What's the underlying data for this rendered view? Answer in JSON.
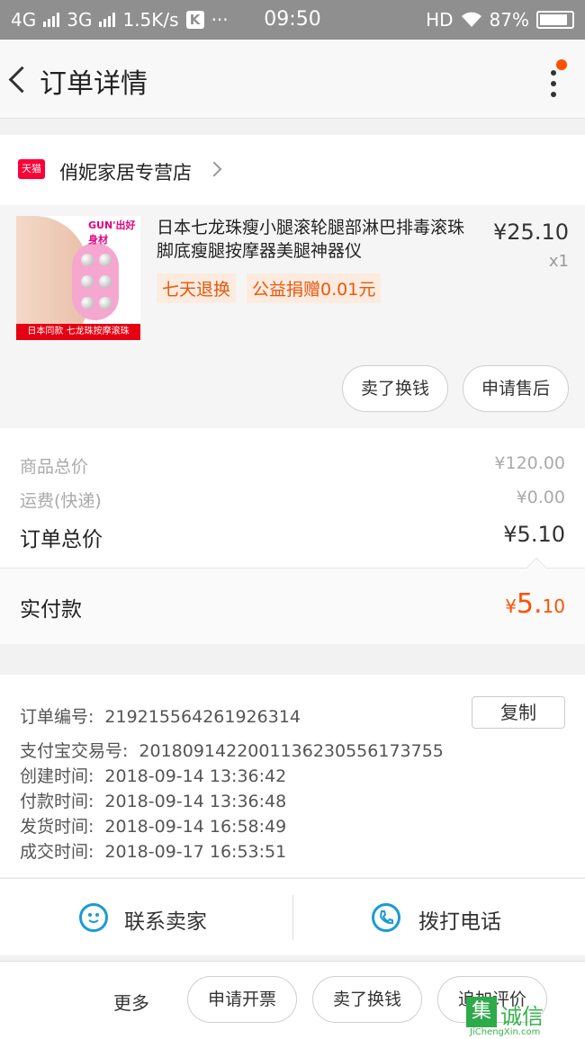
{
  "status_bar": {
    "network_1": "4G",
    "network_2": "3G",
    "speed": "1.5K/s",
    "k_icon": "K",
    "dots": "···",
    "time": "09:50",
    "hd": "HD",
    "battery": "87%"
  },
  "nav": {
    "title": "订单详情"
  },
  "shop": {
    "badge": "天猫",
    "name": "俏妮家居专营店"
  },
  "product": {
    "image_brand": "GUN'出好身材",
    "image_caption": "日本同款 七龙珠按摩滚珠",
    "title": "日本七龙珠瘦小腿滚轮腿部淋巴排毒滚珠脚底瘦腿按摩器美腿神器仪",
    "price": "¥25.10",
    "qty": "x1",
    "tags": [
      "七天退换",
      "公益捐赠0.01元"
    ],
    "buttons": [
      "卖了换钱",
      "申请售后"
    ]
  },
  "summary": {
    "goods_total_label": "商品总价",
    "goods_total_value": "¥120.00",
    "shipping_label": "运费(快递)",
    "shipping_value": "¥0.00",
    "order_total_label": "订单总价",
    "order_total_value": "¥5.10",
    "paid_label": "实付款",
    "paid_currency": "¥",
    "paid_int": "5.",
    "paid_dec": "10"
  },
  "order_info": {
    "copy_label": "复制",
    "rows": [
      {
        "label": "订单编号:",
        "value": "219215564261926314"
      },
      {
        "label": "支付宝交易号:",
        "value": "2018091422001136230556173755"
      },
      {
        "label": "创建时间:",
        "value": "2018-09-14 13:36:42"
      },
      {
        "label": "付款时间:",
        "value": "2018-09-14 13:36:48"
      },
      {
        "label": "发货时间:",
        "value": "2018-09-14 16:58:49"
      },
      {
        "label": "成交时间:",
        "value": "2018-09-17 16:53:51"
      }
    ]
  },
  "contact": {
    "seller_label": "联系卖家",
    "phone_label": "拨打电话"
  },
  "actions": {
    "more_label": "更多",
    "buttons": [
      "申请开票",
      "卖了换钱",
      "追加评价"
    ]
  },
  "watermark": {
    "box": "集",
    "word": "诚信",
    "url": "JiChengXin.com"
  },
  "icons": [
    "back-icon",
    "more-vert-icon",
    "tmall-icon",
    "chevron-right-icon",
    "smile-chat-icon",
    "phone-icon",
    "wifi-icon",
    "battery-icon"
  ],
  "colors": {
    "accent": "#ff5000",
    "link_blue": "#1a9bd7",
    "tmall_red": "#ff0036"
  }
}
